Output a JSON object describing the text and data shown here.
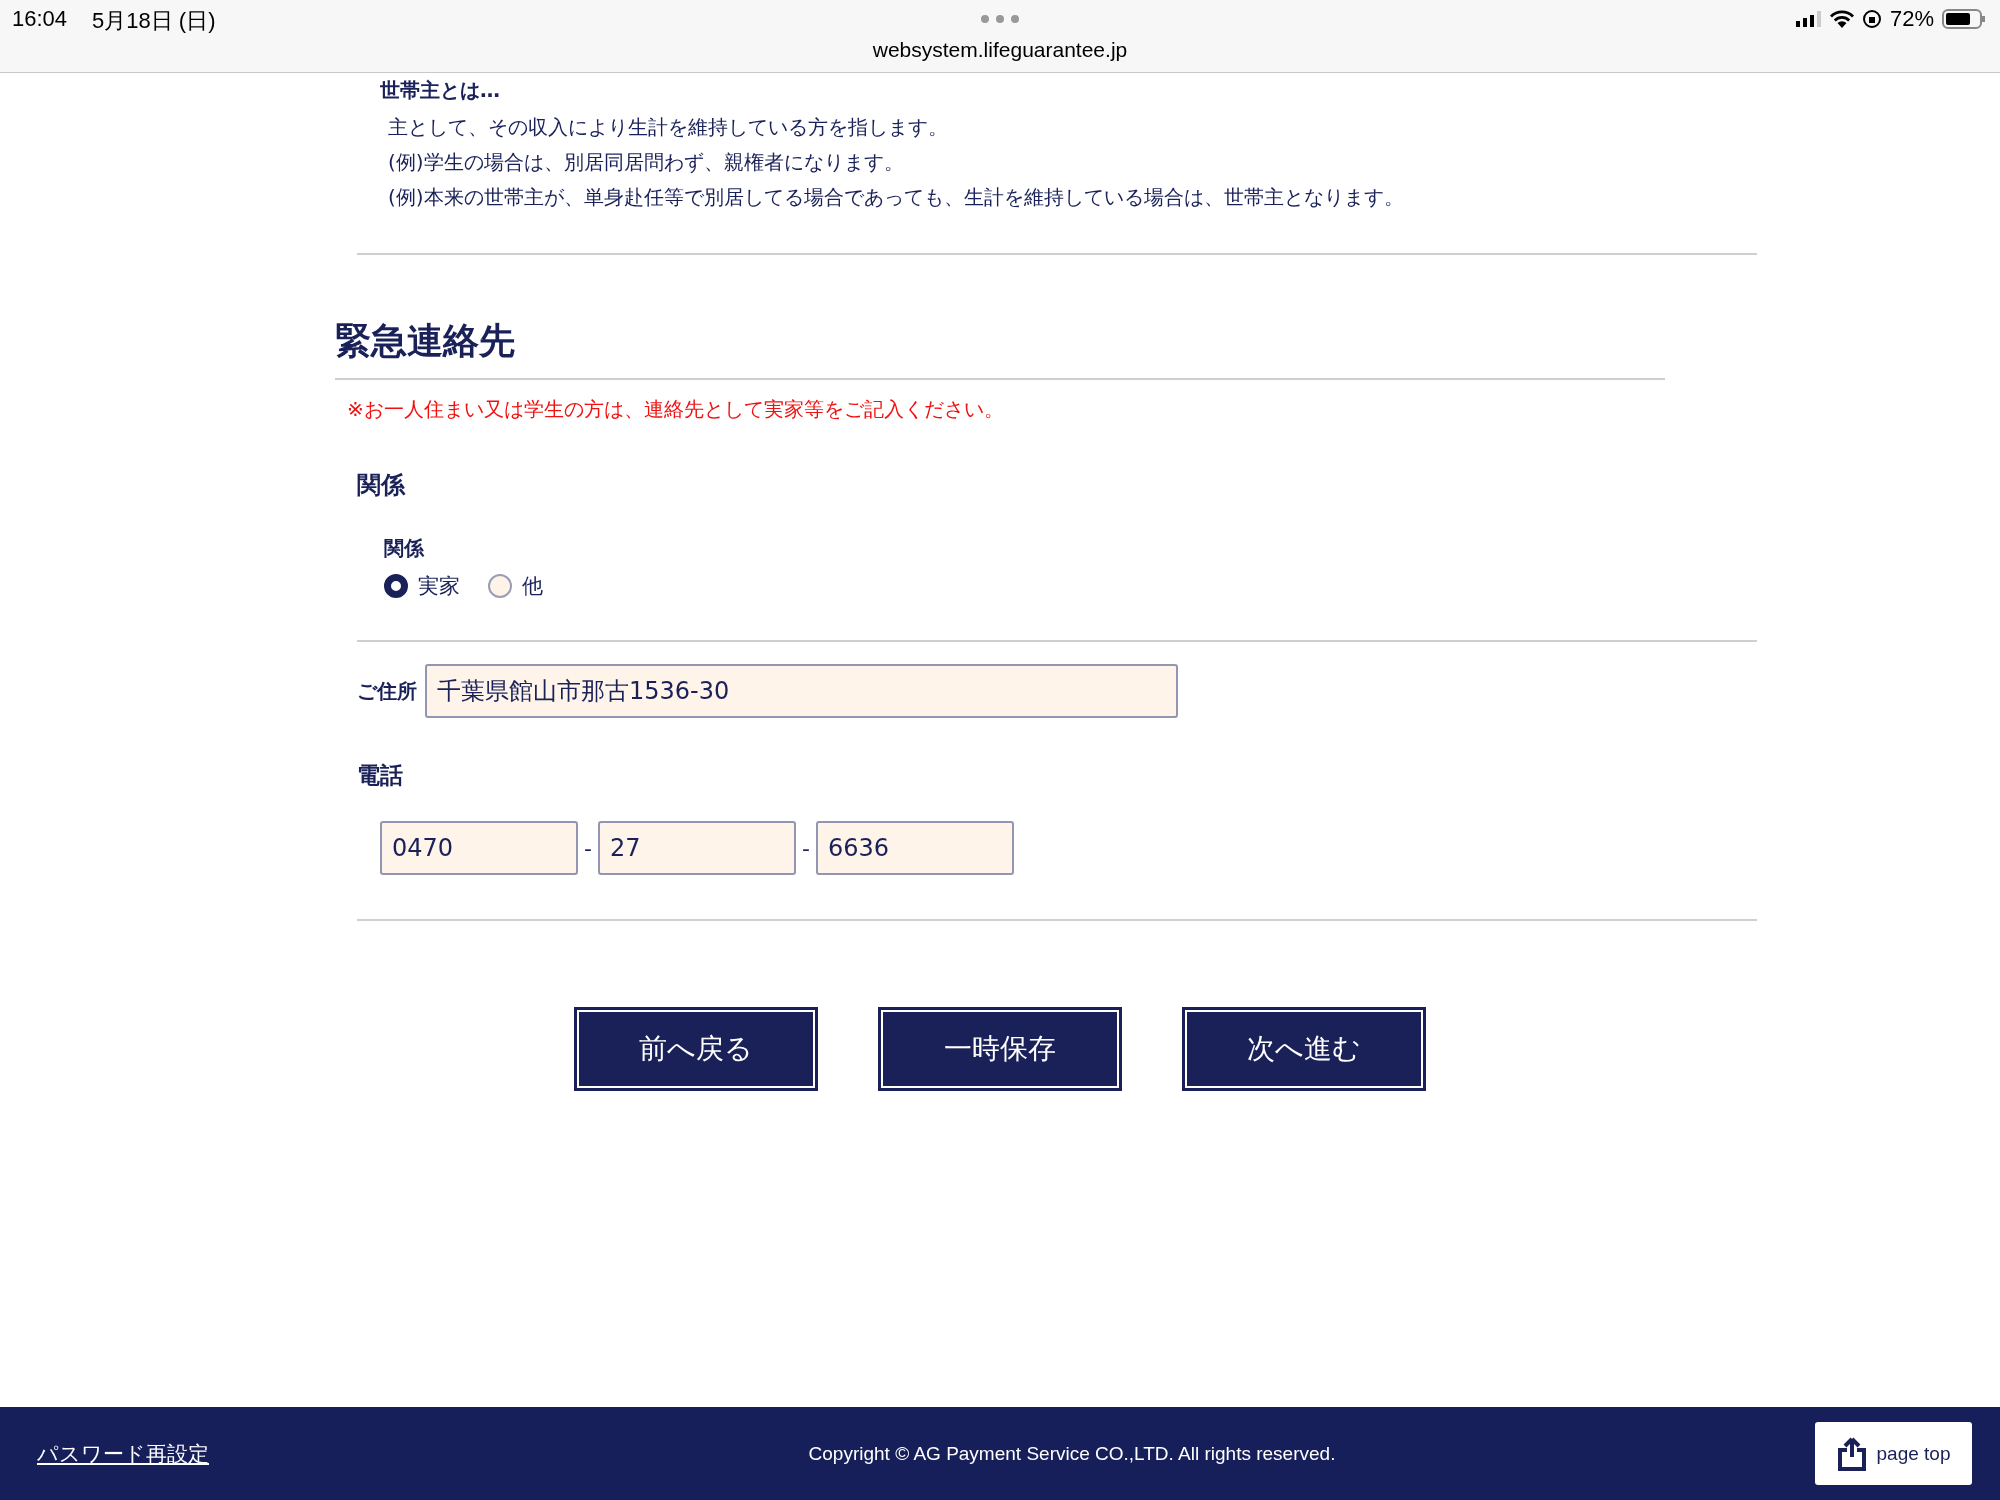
{
  "status_bar": {
    "time": "16:04",
    "date": "5月18日 (日)",
    "url": "websystem.lifeguarantee.jp",
    "battery": "72%"
  },
  "head_of_household_note": {
    "title": "世帯主とは…",
    "lines": [
      "主として、その収入により生計を維持している方を指します。",
      "(例)学生の場合は、別居同居問わず、親権者になります。",
      "(例)本来の世帯主が、単身赴任等で別居してる場合であっても、生計を維持している場合は、世帯主となります。"
    ]
  },
  "section": {
    "title": "緊急連絡先",
    "notice": "※お一人住まい又は学生の方は、連絡先として実家等をご記入ください。",
    "relation": {
      "heading": "関係",
      "label": "関係",
      "options": [
        {
          "label": "実家",
          "selected": true
        },
        {
          "label": "他",
          "selected": false
        }
      ]
    },
    "address": {
      "label": "ご住所",
      "value": "千葉県館山市那古1536-30"
    },
    "phone": {
      "label": "電話",
      "parts": [
        "0470",
        "27",
        "6636"
      ],
      "separator": "-"
    }
  },
  "buttons": [
    "前へ戻る",
    "一時保存",
    "次へ進む"
  ],
  "footer": {
    "link": "パスワード再設定",
    "copyright": "Copyright © AG Payment Service CO.,LTD. All rights reserved.",
    "page_top": "page top"
  }
}
